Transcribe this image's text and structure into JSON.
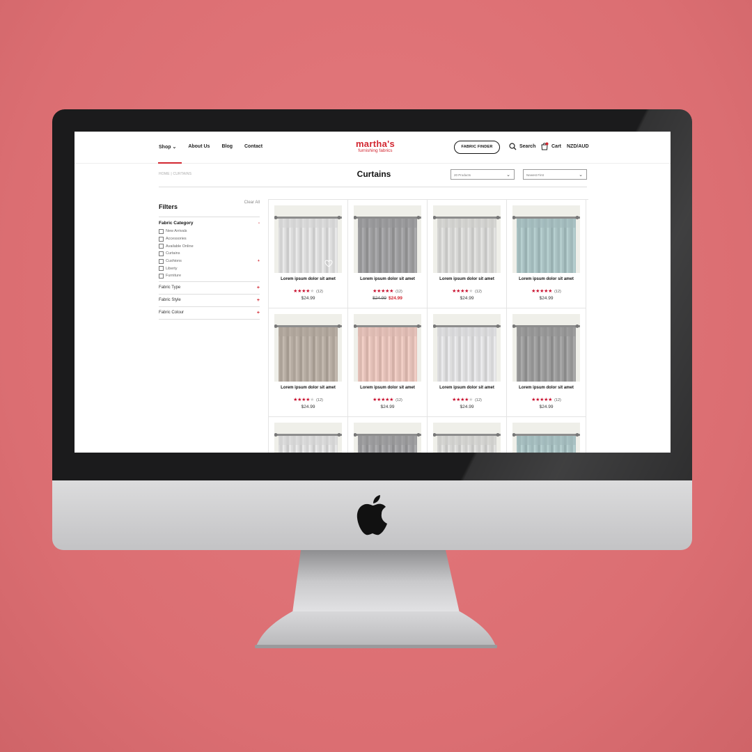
{
  "colors": {
    "background": "#e07377",
    "accent": "#d22630",
    "star": "#c8102e"
  },
  "site": {
    "nav": [
      "Shop",
      "About Us",
      "Blog",
      "Contact"
    ],
    "logo_line1": "martha's",
    "logo_line2": "furnishing fabrics",
    "fabric_finder": "FABRIC FINDER",
    "search": "Search",
    "cart": "Cart",
    "currency": "NZD/AUD"
  },
  "breadcrumb": "HOME  |  CURTAINS",
  "page_title": "Curtains",
  "selects": {
    "count": "20 Products",
    "sort": "Newest First"
  },
  "filters": {
    "title": "Filters",
    "clear": "Clear All",
    "category": "Fabric Category",
    "category_toggle": "-",
    "options": [
      "New Arrivals",
      "Accessories",
      "Available Online",
      "Curtains",
      "Cushions",
      "Liberty",
      "Furniture"
    ],
    "cushions_toggle": "+",
    "sections": [
      "Fabric Type",
      "Fabric Style",
      "Fabric Colour"
    ],
    "section_toggle": "+"
  },
  "products": [
    {
      "name": "Lorem ipsum dolor sit amet",
      "stars": 4,
      "count": "(12)",
      "price": "$24.99",
      "old_price": "",
      "swatch": "#dcdcdc"
    },
    {
      "name": "Lorem ipsum dolor sit amet",
      "stars": 5,
      "count": "(12)",
      "price": "$24.99",
      "old_price": "$24.99",
      "swatch": "#9e9ea0"
    },
    {
      "name": "Lorem ipsum dolor sit amet",
      "stars": 4,
      "count": "(12)",
      "price": "$24.99",
      "old_price": "",
      "swatch": "#d6d6d4"
    },
    {
      "name": "Lorem ipsum dolor sit amet",
      "stars": 5,
      "count": "(12)",
      "price": "$24.99",
      "old_price": "",
      "swatch": "#a9c1c2"
    },
    {
      "name": "Lorem ipsum dolor sit amet",
      "stars": 4,
      "count": "(12)",
      "price": "$24.99",
      "old_price": "",
      "swatch": "#b6aca2"
    },
    {
      "name": "Lorem ipsum dolor sit amet",
      "stars": 5,
      "count": "(12)",
      "price": "$24.99",
      "old_price": "",
      "swatch": "#e4c1b9"
    },
    {
      "name": "Lorem ipsum dolor sit amet",
      "stars": 4,
      "count": "(12)",
      "price": "$24.99",
      "old_price": "",
      "swatch": "#dededf"
    },
    {
      "name": "Lorem ipsum dolor sit amet",
      "stars": 5,
      "count": "(12)",
      "price": "$24.99",
      "old_price": "",
      "swatch": "#9c9c9c"
    },
    {
      "name": "",
      "stars": 0,
      "count": "",
      "price": "",
      "old_price": "",
      "swatch": "#dcdcdc"
    },
    {
      "name": "",
      "stars": 0,
      "count": "",
      "price": "",
      "old_price": "",
      "swatch": "#a0a0a2"
    },
    {
      "name": "",
      "stars": 0,
      "count": "",
      "price": "",
      "old_price": "",
      "swatch": "#d6d6d4"
    },
    {
      "name": "",
      "stars": 0,
      "count": "",
      "price": "",
      "old_price": "",
      "swatch": "#a9c1c2"
    }
  ]
}
